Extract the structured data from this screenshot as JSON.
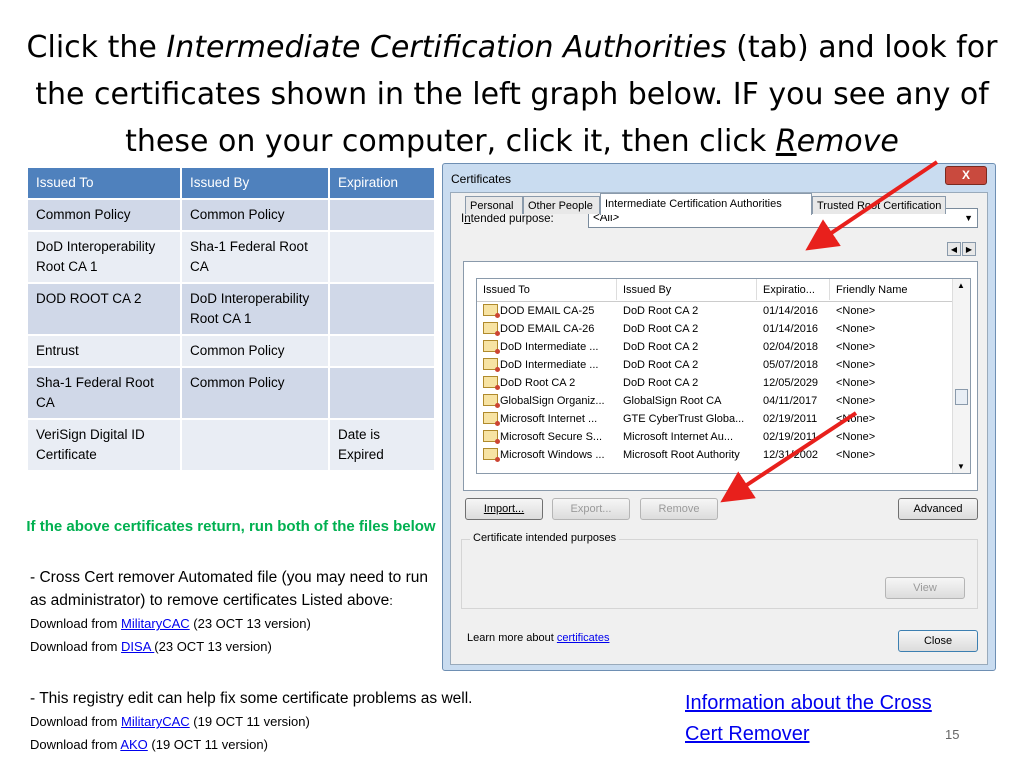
{
  "title": {
    "part1": "Click the ",
    "italic": "Intermediate Certification Authorities",
    "part2": " (tab) and look for the certificates shown in the left graph below.  IF you see any of these on your computer, click it, then click ",
    "remove_first": "R",
    "remove_rest": "emove"
  },
  "table": {
    "headers": [
      "Issued To",
      "Issued By",
      "Expiration"
    ],
    "rows": [
      {
        "issued_to": "Common Policy",
        "issued_by": "Common Policy",
        "expiration": ""
      },
      {
        "issued_to": "DoD Interoperability Root CA 1",
        "issued_by": "Sha-1 Federal Root CA",
        "expiration": ""
      },
      {
        "issued_to": "DOD ROOT CA 2",
        "issued_by": "DoD Interoperability Root CA 1",
        "expiration": ""
      },
      {
        "issued_to": "Entrust",
        "issued_by": "Common Policy",
        "expiration": ""
      },
      {
        "issued_to": "Sha-1 Federal Root CA",
        "issued_by": "Common Policy",
        "expiration": ""
      },
      {
        "issued_to": "VeriSign Digital ID Certificate",
        "issued_by": "",
        "expiration": "Date is Expired"
      }
    ]
  },
  "green_note": "If the above certificates return, run both of the files below",
  "para1": {
    "text": "- Cross Cert remover Automated file (you may need to run as administrator) to remove certificates Listed above",
    "colon": ":",
    "line1_prefix": "Download from ",
    "line1_link": "MilitaryCAC",
    "line1_suffix": " (23 OCT 13 version)",
    "line2_prefix": "Download from ",
    "line2_link": "DISA ",
    "line2_suffix": "(23 OCT 13 version)"
  },
  "para2": {
    "text": "- This registry edit can help fix some certificate problems as well.",
    "line1_prefix": "Download from ",
    "line1_link": "MilitaryCAC",
    "line1_suffix": "  (19 OCT 11 version)",
    "line2_prefix": "Download from ",
    "line2_link": "AKO",
    "line2_suffix": "  (19 OCT 11 version)"
  },
  "info_link": "Information about the Cross Cert Remover",
  "page_number": "15",
  "dialog": {
    "title": "Certificates",
    "close_glyph": "X",
    "purpose_label_first": "I",
    "purpose_label_underlined": "n",
    "purpose_label_rest": "tended purpose:",
    "purpose_value": "<All>",
    "tabs": [
      "Personal",
      "Other People",
      "Intermediate Certification Authorities",
      "Trusted Root Certification"
    ],
    "columns": [
      "Issued To",
      "Issued By",
      "Expiratio...",
      "Friendly Name"
    ],
    "rows": [
      {
        "issued_to": "DOD EMAIL CA-25",
        "issued_by": "DoD Root CA 2",
        "expiration": "01/14/2016",
        "friendly": "<None>"
      },
      {
        "issued_to": "DOD EMAIL CA-26",
        "issued_by": "DoD Root CA 2",
        "expiration": "01/14/2016",
        "friendly": "<None>"
      },
      {
        "issued_to": "DoD Intermediate ...",
        "issued_by": "DoD Root CA 2",
        "expiration": "02/04/2018",
        "friendly": "<None>"
      },
      {
        "issued_to": "DoD Intermediate ...",
        "issued_by": "DoD Root CA 2",
        "expiration": "05/07/2018",
        "friendly": "<None>"
      },
      {
        "issued_to": "DoD Root CA 2",
        "issued_by": "DoD Root CA 2",
        "expiration": "12/05/2029",
        "friendly": "<None>"
      },
      {
        "issued_to": "GlobalSign Organiz...",
        "issued_by": "GlobalSign Root CA",
        "expiration": "04/11/2017",
        "friendly": "<None>"
      },
      {
        "issued_to": "Microsoft Internet ...",
        "issued_by": "GTE CyberTrust Globa...",
        "expiration": "02/19/2011",
        "friendly": "<None>"
      },
      {
        "issued_to": "Microsoft Secure S...",
        "issued_by": "Microsoft Internet Au...",
        "expiration": "02/19/2011",
        "friendly": "<None>"
      },
      {
        "issued_to": "Microsoft Windows ...",
        "issued_by": "Microsoft Root Authority",
        "expiration": "12/31/2002",
        "friendly": "<None>"
      }
    ],
    "buttons": {
      "import": "Import...",
      "export": "Export...",
      "remove": "Remove",
      "advanced": "Advanced",
      "view": "View",
      "close": "Close"
    },
    "purposes_label": "Certificate intended purposes",
    "learn_prefix": "Learn more about ",
    "learn_link": "certificates"
  },
  "colors": {
    "table_header": "#4f81bd",
    "table_row_odd": "#d0d8e8",
    "table_row_even": "#e9edf4",
    "note_green": "#00b050",
    "arrow_red": "#e8201c",
    "link_blue": "#0000ee"
  },
  "icons": [
    "certificate-icon",
    "chevron-down-icon",
    "close-icon",
    "arrow-left-icon",
    "arrow-right-icon"
  ]
}
